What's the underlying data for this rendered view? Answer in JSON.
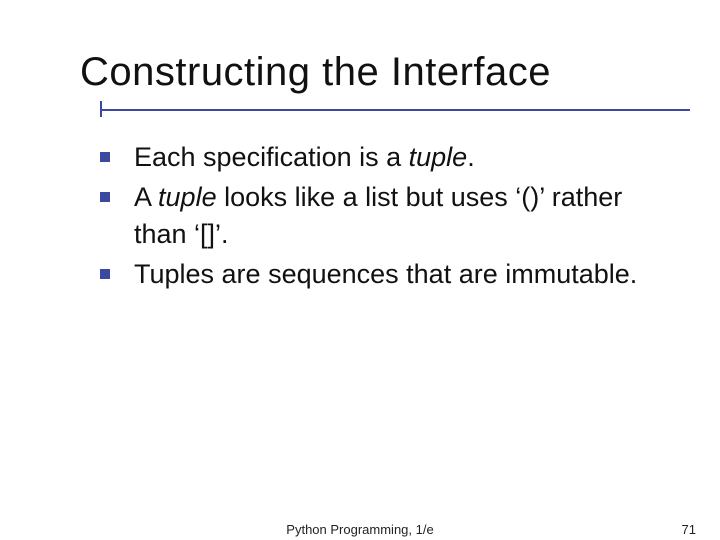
{
  "title": "Constructing the Interface",
  "bullets": [
    {
      "pre": "Each specification is a ",
      "em": "tuple",
      "post": "."
    },
    {
      "pre": "A ",
      "em": "tuple",
      "post": " looks like a list but uses ‘()’ rather than ‘[]’."
    },
    {
      "pre": "Tuples are sequences that are immutable.",
      "em": "",
      "post": ""
    }
  ],
  "footer": {
    "center": "Python Programming, 1/e",
    "page": "71"
  },
  "colors": {
    "accent": "#3b4aa0"
  }
}
